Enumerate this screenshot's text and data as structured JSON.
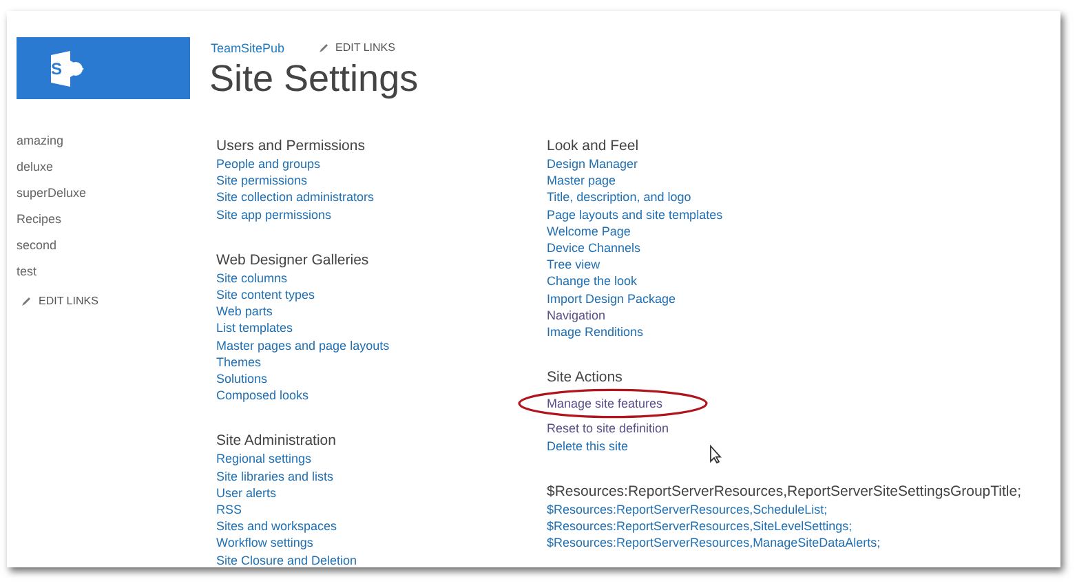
{
  "logo": {
    "letter": "S"
  },
  "breadcrumb": {
    "site": "TeamSitePub",
    "edit_links": "EDIT LINKS"
  },
  "title": "Site Settings",
  "sidebar": {
    "items": [
      "amazing",
      "deluxe",
      "superDeluxe",
      "Recipes",
      "second",
      "test"
    ],
    "edit_links": "EDIT LINKS"
  },
  "columns": [
    [
      {
        "heading": "Users and Permissions",
        "links": [
          {
            "label": "People and groups",
            "visited": false
          },
          {
            "label": "Site permissions",
            "visited": false
          },
          {
            "label": "Site collection administrators",
            "visited": false
          },
          {
            "label": "Site app permissions",
            "visited": false
          }
        ]
      },
      {
        "heading": "Web Designer Galleries",
        "links": [
          {
            "label": "Site columns",
            "visited": false
          },
          {
            "label": "Site content types",
            "visited": false
          },
          {
            "label": "Web parts",
            "visited": false
          },
          {
            "label": "List templates",
            "visited": false
          },
          {
            "label": "Master pages and page layouts",
            "visited": false
          },
          {
            "label": "Themes",
            "visited": false
          },
          {
            "label": "Solutions",
            "visited": false
          },
          {
            "label": "Composed looks",
            "visited": false
          }
        ]
      },
      {
        "heading": "Site Administration",
        "links": [
          {
            "label": "Regional settings",
            "visited": false
          },
          {
            "label": "Site libraries and lists",
            "visited": false
          },
          {
            "label": "User alerts",
            "visited": false
          },
          {
            "label": "RSS",
            "visited": false
          },
          {
            "label": "Sites and workspaces",
            "visited": false
          },
          {
            "label": "Workflow settings",
            "visited": false
          },
          {
            "label": "Site Closure and Deletion",
            "visited": false
          }
        ]
      }
    ],
    [
      {
        "heading": "Look and Feel",
        "links": [
          {
            "label": "Design Manager",
            "visited": false
          },
          {
            "label": "Master page",
            "visited": false
          },
          {
            "label": "Title, description, and logo",
            "visited": false
          },
          {
            "label": "Page layouts and site templates",
            "visited": false
          },
          {
            "label": "Welcome Page",
            "visited": false
          },
          {
            "label": "Device Channels",
            "visited": false
          },
          {
            "label": "Tree view",
            "visited": false
          },
          {
            "label": "Change the look",
            "visited": false
          },
          {
            "label": "Import Design Package",
            "visited": false
          },
          {
            "label": "Navigation",
            "visited": true
          },
          {
            "label": "Image Renditions",
            "visited": false
          }
        ]
      },
      {
        "heading": "Site Actions",
        "links": [
          {
            "label": "Manage site features",
            "visited": true,
            "circled": true
          },
          {
            "label": "Reset to site definition",
            "visited": true,
            "circled": false
          },
          {
            "label": "Delete this site",
            "visited": false,
            "circled": false
          }
        ]
      },
      {
        "heading": "$Resources:ReportServerResources,ReportServerSiteSettingsGroupTitle;",
        "links": [
          {
            "label": "$Resources:ReportServerResources,ScheduleList;",
            "visited": false
          },
          {
            "label": "$Resources:ReportServerResources,SiteLevelSettings;",
            "visited": false
          },
          {
            "label": "$Resources:ReportServerResources,ManageSiteDataAlerts;",
            "visited": false
          }
        ]
      }
    ]
  ]
}
